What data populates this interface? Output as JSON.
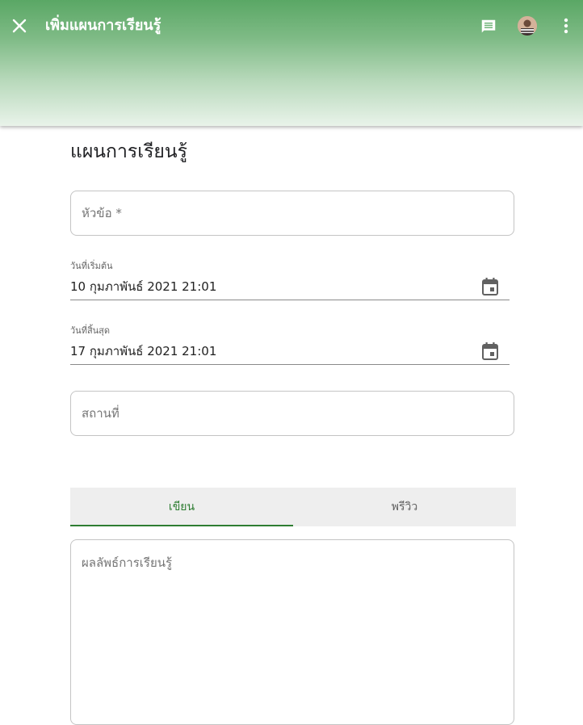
{
  "appbar": {
    "title": "เพิ่มแผนการเรียนรู้",
    "icons": [
      "close-icon",
      "comment-icon",
      "avatar",
      "more-vert-icon"
    ],
    "colors": {
      "gradient_top": "#5aa765",
      "gradient_bottom": "#e9f3ea"
    }
  },
  "form": {
    "heading": "แผนการเรียนรู้",
    "title_field": {
      "placeholder": "หัวข้อ *",
      "value": ""
    },
    "start_date": {
      "label": "วันที่เริ่มต้น",
      "value": "10 กุมภาพันธ์ 2021 21:01"
    },
    "end_date": {
      "label": "วันที่สิ้นสุด",
      "value": "17 กุมภาพันธ์ 2021 21:01"
    },
    "location_field": {
      "placeholder": "สถานที่",
      "value": ""
    },
    "tabs": [
      {
        "label": "เขียน",
        "active": true
      },
      {
        "label": "พรีวิว",
        "active": false
      }
    ],
    "content_field": {
      "placeholder": "ผลลัพธ์การเรียนรู้",
      "value": ""
    }
  },
  "theme": {
    "accent": "#2e7d32"
  }
}
